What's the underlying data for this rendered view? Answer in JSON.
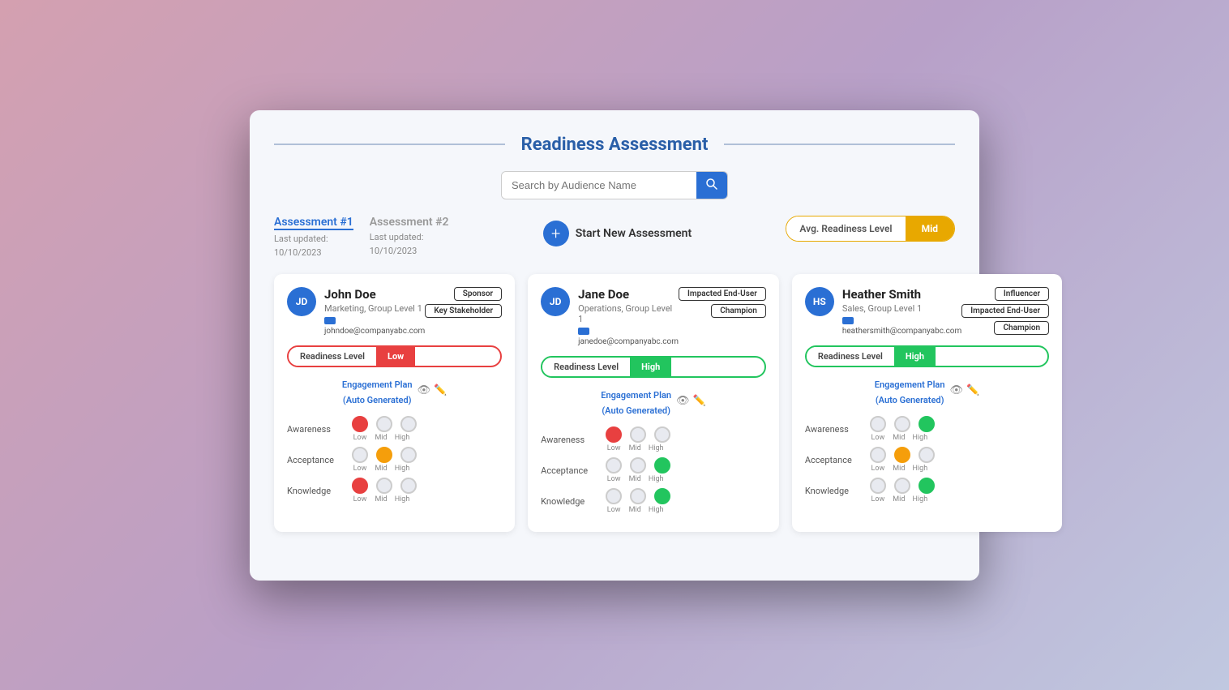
{
  "page": {
    "title": "Readiness Assessment"
  },
  "search": {
    "placeholder": "Search by Audience Name"
  },
  "assessments": [
    {
      "id": "assessment-1",
      "label": "Assessment #1",
      "active": true,
      "last_updated_prefix": "Last updated:",
      "last_updated": "10/10/2023"
    },
    {
      "id": "assessment-2",
      "label": "Assessment #2",
      "active": false,
      "last_updated_prefix": "Last updated:",
      "last_updated": "10/10/2023"
    }
  ],
  "new_assessment": {
    "label": "Start New Assessment"
  },
  "avg_readiness": {
    "label": "Avg. Readiness Level",
    "value": "Mid"
  },
  "people": [
    {
      "id": "john-doe",
      "avatar_initials": "JD",
      "name": "John Doe",
      "department": "Marketing, Group Level 1",
      "email": "johndoe@companyabc.com",
      "tags": [
        "Sponsor",
        "Key Stakeholder"
      ],
      "readiness_level": "Low",
      "readiness_class": "low",
      "engagement_plan": "Engagement Plan",
      "engagement_plan_sub": "(Auto Generated)",
      "metrics": [
        {
          "label": "Awareness",
          "selected": "low",
          "options": [
            "low",
            "mid",
            "high"
          ]
        },
        {
          "label": "Acceptance",
          "selected": "mid",
          "options": [
            "low",
            "mid",
            "high"
          ]
        },
        {
          "label": "Knowledge",
          "selected": "low",
          "options": [
            "low",
            "mid",
            "high"
          ]
        }
      ]
    },
    {
      "id": "jane-doe",
      "avatar_initials": "JD",
      "name": "Jane Doe",
      "department": "Operations, Group Level 1",
      "email": "janedoe@companyabc.com",
      "tags": [
        "Impacted End-User",
        "Champion"
      ],
      "readiness_level": "High",
      "readiness_class": "high",
      "engagement_plan": "Engagement Plan",
      "engagement_plan_sub": "(Auto Generated)",
      "metrics": [
        {
          "label": "Awareness",
          "selected": "low",
          "options": [
            "low",
            "mid",
            "high"
          ]
        },
        {
          "label": "Acceptance",
          "selected": "high",
          "options": [
            "low",
            "mid",
            "high"
          ]
        },
        {
          "label": "Knowledge",
          "selected": "high",
          "options": [
            "low",
            "mid",
            "high"
          ]
        }
      ]
    },
    {
      "id": "heather-smith",
      "avatar_initials": "HS",
      "name": "Heather Smith",
      "department": "Sales, Group Level 1",
      "email": "heathersmith@companyabc.com",
      "tags": [
        "Influencer",
        "Impacted End-User",
        "Champion"
      ],
      "readiness_level": "High",
      "readiness_class": "high",
      "engagement_plan": "Engagement Plan",
      "engagement_plan_sub": "(Auto Generated)",
      "metrics": [
        {
          "label": "Awareness",
          "selected": "high",
          "options": [
            "low",
            "mid",
            "high"
          ]
        },
        {
          "label": "Acceptance",
          "selected": "mid",
          "options": [
            "low",
            "mid",
            "high"
          ]
        },
        {
          "label": "Knowledge",
          "selected": "high",
          "options": [
            "low",
            "mid",
            "high"
          ]
        }
      ]
    }
  ],
  "metric_labels": {
    "low": "Low",
    "mid": "Mid",
    "high": "High"
  }
}
